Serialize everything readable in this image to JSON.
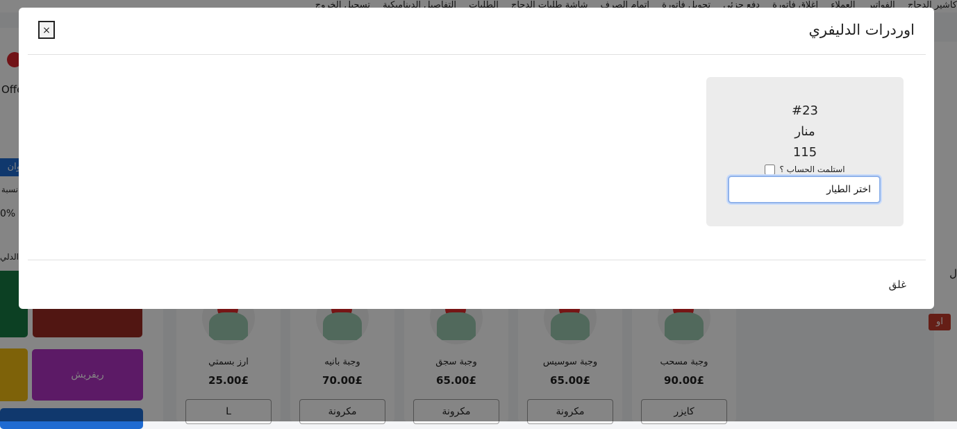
{
  "background": {
    "nav_items": [
      "كاشير الدجاج",
      "الفواتير",
      "العملاء",
      "اغلاق فاتورة",
      "دفع جزئي",
      "تحويل فاتورة",
      "اتمام الصرف",
      "شاشة طلبات الدجاج",
      "الطلبات",
      "التفاصيل الديناميكية",
      "تسجيل الخروج"
    ],
    "offer_label": "Offe",
    "address_button": "وان",
    "percent_label": "نسبة",
    "percent_value": "0%",
    "delivery_label": "ة الدلي",
    "categories": {
      "red": "",
      "purple": "ريفريش"
    },
    "side_text": "ل",
    "side_badge": "او",
    "products": [
      {
        "name": "ارز بسمتي",
        "price": "25.00£",
        "option": "L"
      },
      {
        "name": "وجبة بانيه",
        "price": "70.00£",
        "option": "مكرونة"
      },
      {
        "name": "وجبة سجق",
        "price": "65.00£",
        "option": "مكرونة"
      },
      {
        "name": "وجبة سوسيس",
        "price": "65.00£",
        "option": "مكرونة"
      },
      {
        "name": "وجبة مسحب",
        "price": "90.00£",
        "option": "كايزر"
      }
    ]
  },
  "modal": {
    "title": "اوردرات الدليفري",
    "close_symbol": "×",
    "order": {
      "number": "#23",
      "customer": "منار",
      "amount": "115",
      "received_label": "استلمت الحساب ؟",
      "received_checked": false,
      "driver_select_value": "اختر الطيار"
    },
    "footer_close": "غلق"
  }
}
